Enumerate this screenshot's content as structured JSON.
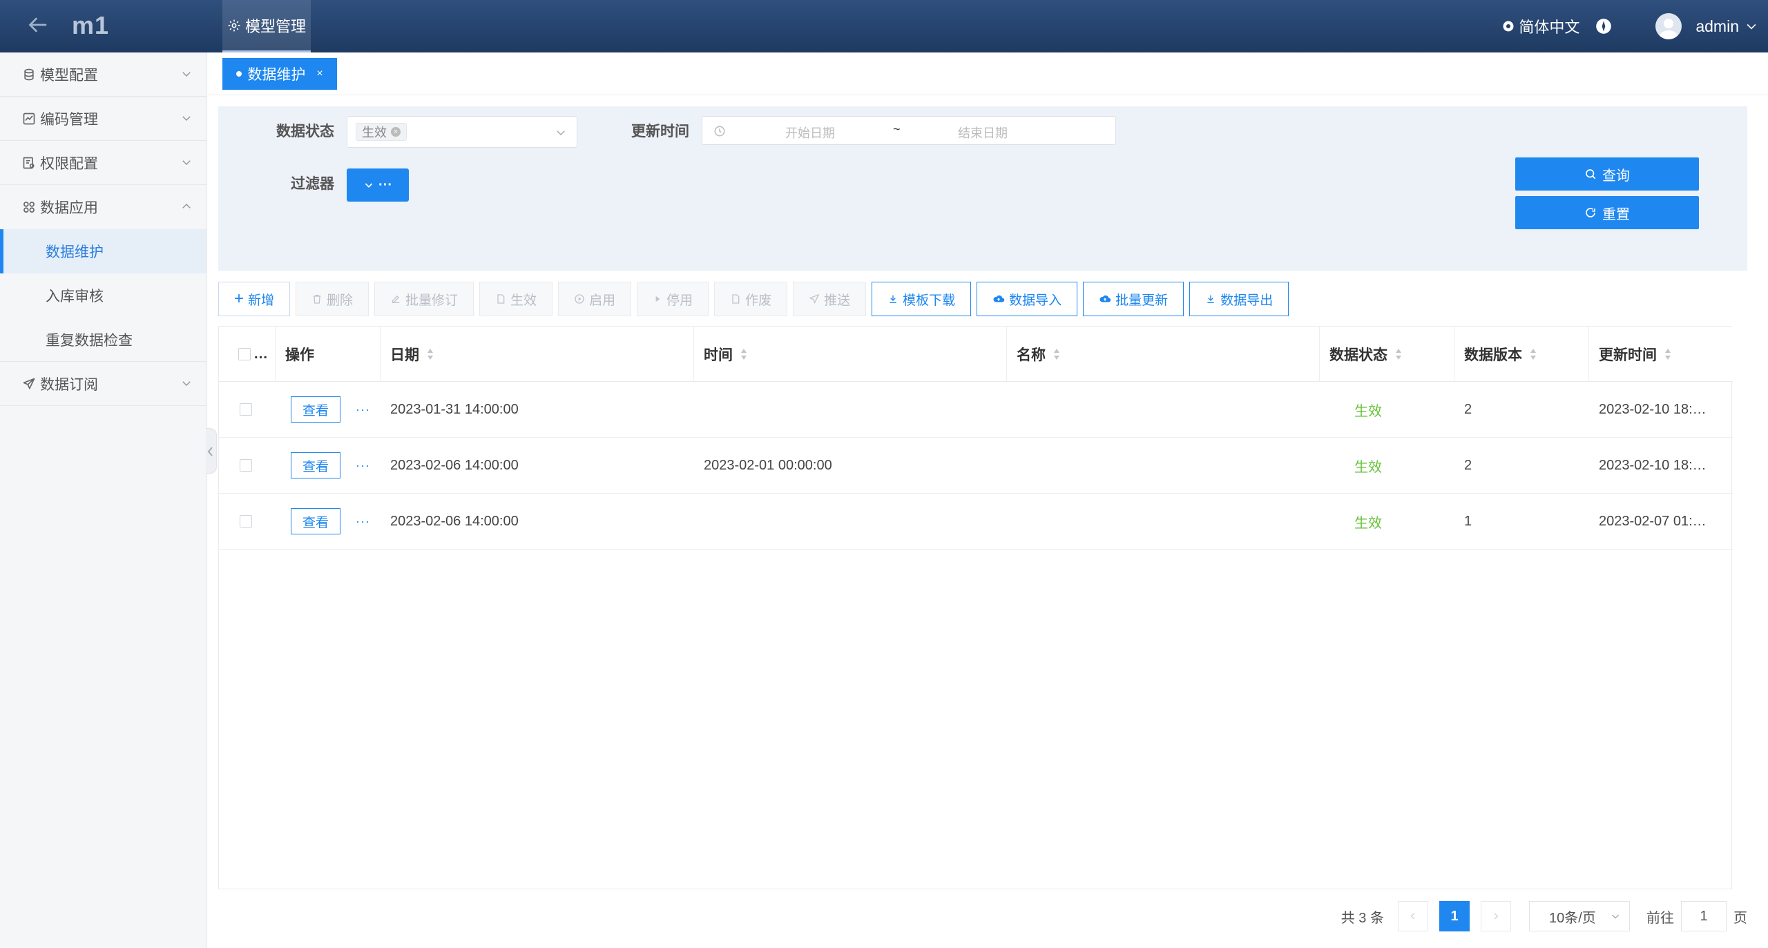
{
  "app": {
    "title": "m1"
  },
  "topbar": {
    "module_tab": "模型管理",
    "language": "简体中文",
    "user": "admin"
  },
  "sidebar": {
    "items": [
      {
        "label": "模型配置",
        "icon": "database-icon"
      },
      {
        "label": "编码管理",
        "icon": "chart-icon"
      },
      {
        "label": "权限配置",
        "icon": "permission-icon"
      },
      {
        "label": "数据应用",
        "icon": "apps-icon"
      },
      {
        "label": "数据订阅",
        "icon": "send-icon"
      }
    ],
    "sub_items": [
      {
        "label": "数据维护",
        "active": true
      },
      {
        "label": "入库审核"
      },
      {
        "label": "重复数据检查"
      }
    ]
  },
  "tabs": {
    "active": "数据维护"
  },
  "filters": {
    "status_label": "数据状态",
    "status_value": "生效",
    "update_time_label": "更新时间",
    "start_placeholder": "开始日期",
    "range_sep": "~",
    "end_placeholder": "结束日期",
    "filter_label": "过滤器",
    "filter_button": "···",
    "query_button": "查询",
    "reset_button": "重置"
  },
  "toolbar": {
    "add": "新增",
    "delete": "删除",
    "batch_revise": "批量修订",
    "effective": "生效",
    "enable": "启用",
    "disable": "停用",
    "void": "作废",
    "push": "推送",
    "template_download": "模板下载",
    "data_import": "数据导入",
    "batch_update": "批量更新",
    "data_export": "数据导出"
  },
  "table": {
    "headers": {
      "select": "…",
      "actions": "操作",
      "date": "日期",
      "time": "时间",
      "name": "名称",
      "status": "数据状态",
      "version": "数据版本",
      "updated": "更新时间"
    },
    "view_label": "查看",
    "more_label": "···",
    "rows": [
      {
        "date": "2023-01-31 14:00:00",
        "time": "",
        "name": "",
        "status": "生效",
        "version": "2",
        "updated": "2023-02-10 18:…"
      },
      {
        "date": "2023-02-06 14:00:00",
        "time": "2023-02-01 00:00:00",
        "name": "",
        "status": "生效",
        "version": "2",
        "updated": "2023-02-10 18:…"
      },
      {
        "date": "2023-02-06 14:00:00",
        "time": "",
        "name": "",
        "status": "生效",
        "version": "1",
        "updated": "2023-02-07 01:…"
      }
    ]
  },
  "pagination": {
    "total": "共 3 条",
    "current": "1",
    "page_size": "10条/页",
    "goto_label": "前往",
    "goto_value": "1",
    "page_suffix": "页"
  },
  "colors": {
    "primary": "#1e87f0",
    "topbar": "#24416b",
    "success": "#67c23a"
  }
}
